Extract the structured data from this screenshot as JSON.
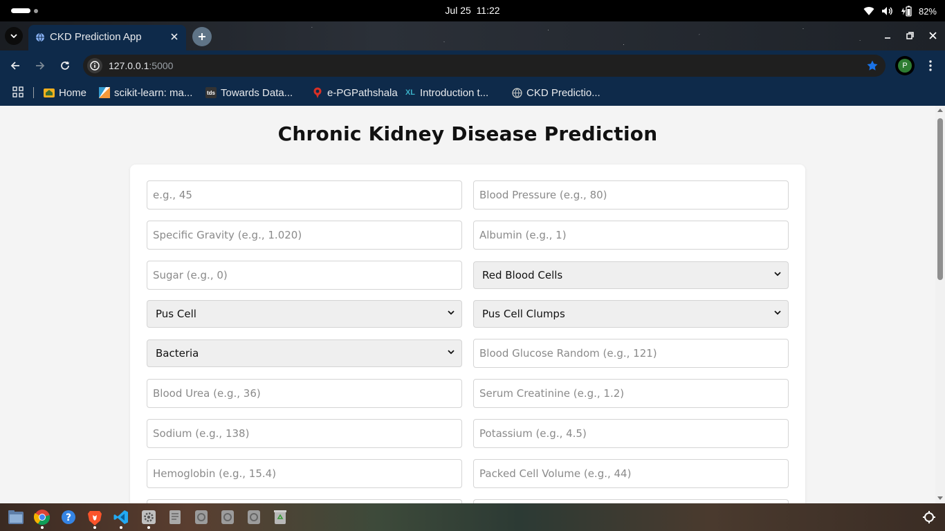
{
  "system": {
    "date": "Jul 25",
    "time": "11:22",
    "battery": "82%"
  },
  "browser": {
    "tab_title": "CKD Prediction App",
    "url_host": "127.0.0.1",
    "url_port": ":5000",
    "profile_initial": "P",
    "bookmarks": [
      {
        "label": "Home",
        "icon": "home-folder-icon"
      },
      {
        "label": "scikit-learn: ma...",
        "icon": "scikit-learn-icon"
      },
      {
        "label": "Towards Data...",
        "icon": "tds-icon"
      },
      {
        "label": "e-PGPathshala",
        "icon": "epg-icon"
      },
      {
        "label": "Introduction t...",
        "icon": "xl-icon"
      },
      {
        "label": "CKD Predictio...",
        "icon": "globe-icon"
      }
    ],
    "tds_icon_text": "tds",
    "xl_icon_text": "XL"
  },
  "page": {
    "title": "Chronic Kidney Disease Prediction",
    "fields": {
      "age": {
        "placeholder": "e.g., 45"
      },
      "blood_pressure": {
        "placeholder": "Blood Pressure (e.g., 80)"
      },
      "specific_gravity": {
        "placeholder": "Specific Gravity (e.g., 1.020)"
      },
      "albumin": {
        "placeholder": "Albumin (e.g., 1)"
      },
      "sugar": {
        "placeholder": "Sugar (e.g., 0)"
      },
      "red_blood_cells": {
        "selected": "Red Blood Cells"
      },
      "pus_cell": {
        "selected": "Pus Cell"
      },
      "pus_cell_clumps": {
        "selected": "Pus Cell Clumps"
      },
      "bacteria": {
        "selected": "Bacteria"
      },
      "blood_glucose_random": {
        "placeholder": "Blood Glucose Random (e.g., 121)"
      },
      "blood_urea": {
        "placeholder": "Blood Urea (e.g., 36)"
      },
      "serum_creatinine": {
        "placeholder": "Serum Creatinine (e.g., 1.2)"
      },
      "sodium": {
        "placeholder": "Sodium (e.g., 138)"
      },
      "potassium": {
        "placeholder": "Potassium (e.g., 4.5)"
      },
      "hemoglobin": {
        "placeholder": "Hemoglobin (e.g., 15.4)"
      },
      "packed_cell_volume": {
        "placeholder": "Packed Cell Volume (e.g., 44)"
      }
    }
  },
  "colors": {
    "chrome_frame": "#0e2a4a",
    "page_bg": "#f4f4f4",
    "card_bg": "#ffffff",
    "select_bg": "#efefef",
    "placeholder": "#8a8a8a"
  }
}
